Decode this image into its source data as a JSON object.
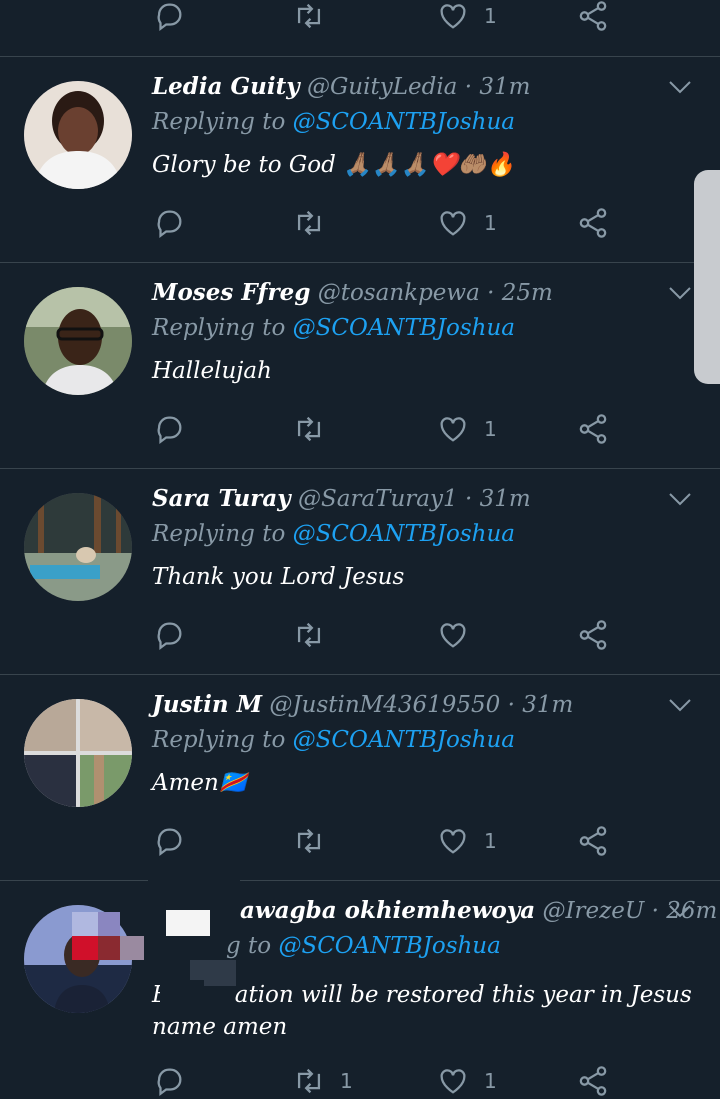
{
  "top_actions": {
    "like_count": "1"
  },
  "tweets": [
    {
      "name": "Ledia Guity",
      "handle": "@GuityLedia",
      "sep": "·",
      "time": "31m",
      "reply_prefix": "Replying to",
      "reply_to": "@SCOANTBJoshua",
      "text": "Glory be to God 🙏🏽🙏🏽🙏🏽❤️🤲🏽🔥",
      "retweet_count": "",
      "like_count": "1"
    },
    {
      "name": "Moses Ffreg",
      "handle": "@tosankpewa",
      "sep": "·",
      "time": "25m",
      "reply_prefix": "Replying to",
      "reply_to": "@SCOANTBJoshua",
      "text": "Hallelujah",
      "retweet_count": "",
      "like_count": "1"
    },
    {
      "name": "Sara Turay",
      "handle": "@SaraTuray1",
      "sep": "·",
      "time": "31m",
      "reply_prefix": "Replying to",
      "reply_to": "@SCOANTBJoshua",
      "text": "Thank you Lord Jesus",
      "retweet_count": "",
      "like_count": ""
    },
    {
      "name": "Justin M",
      "handle": "@JustinM43619550",
      "sep": "·",
      "time": "31m",
      "reply_prefix": "Replying to",
      "reply_to": "@SCOANTBJoshua",
      "text": "Amen🇨🇩",
      "retweet_count": "",
      "like_count": "1"
    },
    {
      "name": "awagba okhiemhewoya",
      "handle": "@IrezeU",
      "sep": "·",
      "time": "26m",
      "reply_prefix": "g to",
      "reply_to": "@SCOANTBJoshua",
      "text": "Bl        ation will be restored this year in Jesus name amen",
      "retweet_count": "1",
      "like_count": "1"
    }
  ],
  "colors": {
    "background": "#15202b",
    "divider": "#38444d",
    "muted": "#8899a6",
    "mention": "#1da1f2"
  }
}
